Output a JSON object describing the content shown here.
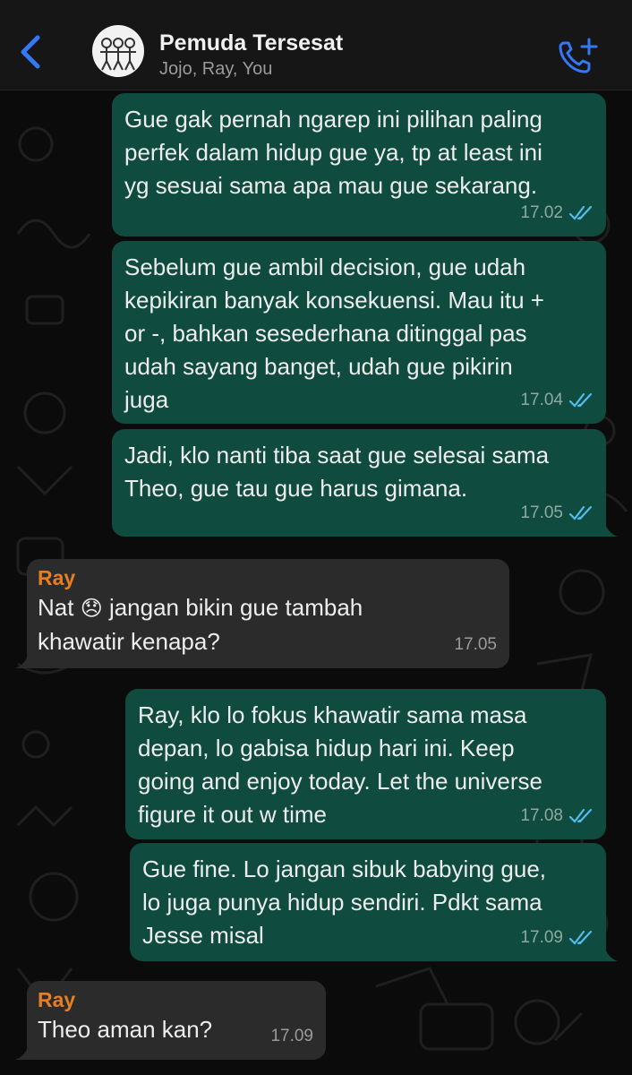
{
  "header": {
    "back_icon": "chevron-left-icon",
    "group_name": "Pemuda Tersesat",
    "members": "Jojo, Ray, You",
    "call_icon": "add-call-icon",
    "accent": "#3478f6"
  },
  "messages": [
    {
      "direction": "out",
      "text": "Gue gak pernah ngarep ini pilihan paling\nperfek dalam hidup gue ya, tp at least ini\nyg sesuai sama apa mau gue sekarang.",
      "time": "17.02",
      "status": "read"
    },
    {
      "direction": "out",
      "text": "Sebelum gue ambil decision, gue udah\nkepikiran banyak konsekuensi. Mau itu +\nor -, bahkan sesederhana ditinggal pas\nudah sayang banget, udah gue pikirin\njuga",
      "time": "17.04",
      "status": "read"
    },
    {
      "direction": "out",
      "text": "Jadi, klo nanti tiba saat gue selesai sama\nTheo, gue tau gue harus gimana.",
      "time": "17.05",
      "status": "read"
    },
    {
      "direction": "in",
      "sender": "Ray",
      "text_before_emoji": "Nat ",
      "emoji": "😞",
      "text_after_emoji": " jangan bikin gue tambah",
      "text_line2": "khawatir kenapa?",
      "time": "17.05"
    },
    {
      "direction": "out",
      "text": "Ray, klo lo fokus khawatir sama masa\ndepan, lo gabisa hidup hari ini. Keep\ngoing and enjoy today. Let the universe\nfigure it out w time",
      "time": "17.08",
      "status": "read"
    },
    {
      "direction": "out",
      "text": "Gue fine. Lo jangan sibuk babying gue,\nlo juga punya hidup sendiri. Pdkt sama\nJesse misal",
      "time": "17.09",
      "status": "read"
    },
    {
      "direction": "in",
      "sender": "Ray",
      "text": "Theo aman kan?",
      "time": "17.09"
    }
  ],
  "colors": {
    "outgoing_bubble": "#0f4b3e",
    "incoming_bubble": "#2b2b2b",
    "sender_name": "#e67e22",
    "read_ticks": "#53bdeb"
  }
}
